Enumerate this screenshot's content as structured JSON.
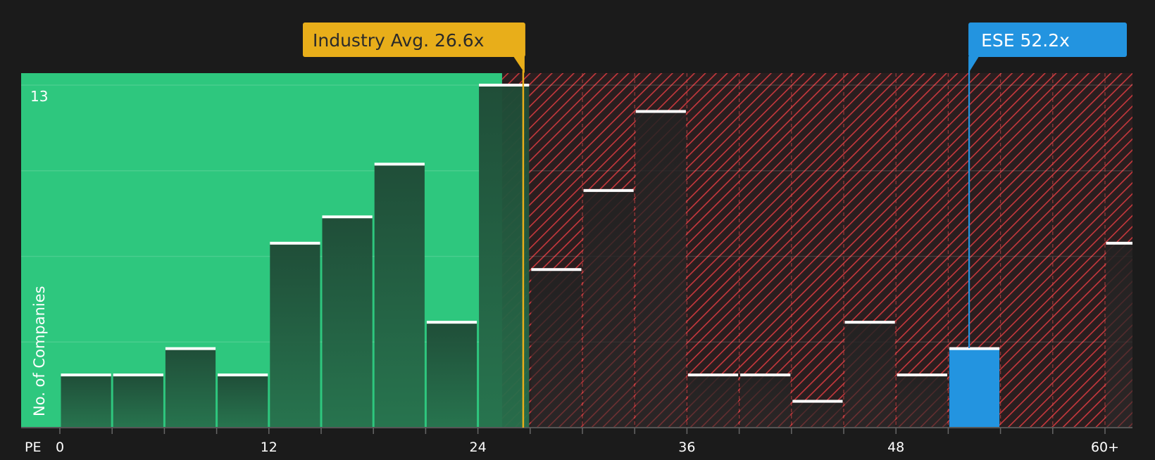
{
  "chart_data": {
    "type": "bar",
    "x_axis_label": "PE",
    "y_axis_label": "No. of Companies",
    "y_tick_label": "13",
    "ylim": [
      0,
      13.5
    ],
    "x_ticks": [
      "0",
      "12",
      "24",
      "36",
      "48",
      "60+"
    ],
    "bins": [
      {
        "start": 0,
        "end": 3,
        "count": 2
      },
      {
        "start": 3,
        "end": 6,
        "count": 2
      },
      {
        "start": 6,
        "end": 9,
        "count": 3
      },
      {
        "start": 9,
        "end": 12,
        "count": 2
      },
      {
        "start": 12,
        "end": 15,
        "count": 7
      },
      {
        "start": 15,
        "end": 18,
        "count": 8
      },
      {
        "start": 18,
        "end": 21,
        "count": 10
      },
      {
        "start": 21,
        "end": 24,
        "count": 4
      },
      {
        "start": 24,
        "end": 27,
        "count": 13
      },
      {
        "start": 27,
        "end": 30,
        "count": 6
      },
      {
        "start": 30,
        "end": 33,
        "count": 9
      },
      {
        "start": 33,
        "end": 36,
        "count": 12
      },
      {
        "start": 36,
        "end": 39,
        "count": 2
      },
      {
        "start": 39,
        "end": 42,
        "count": 2
      },
      {
        "start": 42,
        "end": 45,
        "count": 1
      },
      {
        "start": 45,
        "end": 48,
        "count": 4
      },
      {
        "start": 48,
        "end": 51,
        "count": 2
      },
      {
        "start": 51,
        "end": 54,
        "count": 3
      },
      {
        "start": 54,
        "end": 57,
        "count": 0
      },
      {
        "start": 57,
        "end": 60,
        "count": 0
      },
      {
        "start": 60,
        "end": 63,
        "count": 7
      }
    ],
    "highlighted_bin_start": 51,
    "industry_average": {
      "label": "Industry Avg. 26.6x",
      "value": 26.6
    },
    "company": {
      "label": "ESE 52.2x",
      "value": 52.2
    },
    "colors": {
      "background": "#1b1b1b",
      "undervalued_zone": "#2ec77e",
      "overvalued_hatch": "#c8383d",
      "bar_dark": "#1f4a36",
      "bar_light": "#28704c",
      "bar_cap": "#ffffff",
      "highlight_bar": "#2394e0",
      "industry_avg": "#e8ae1a",
      "company": "#2394e0",
      "text": "#ffffff"
    }
  }
}
